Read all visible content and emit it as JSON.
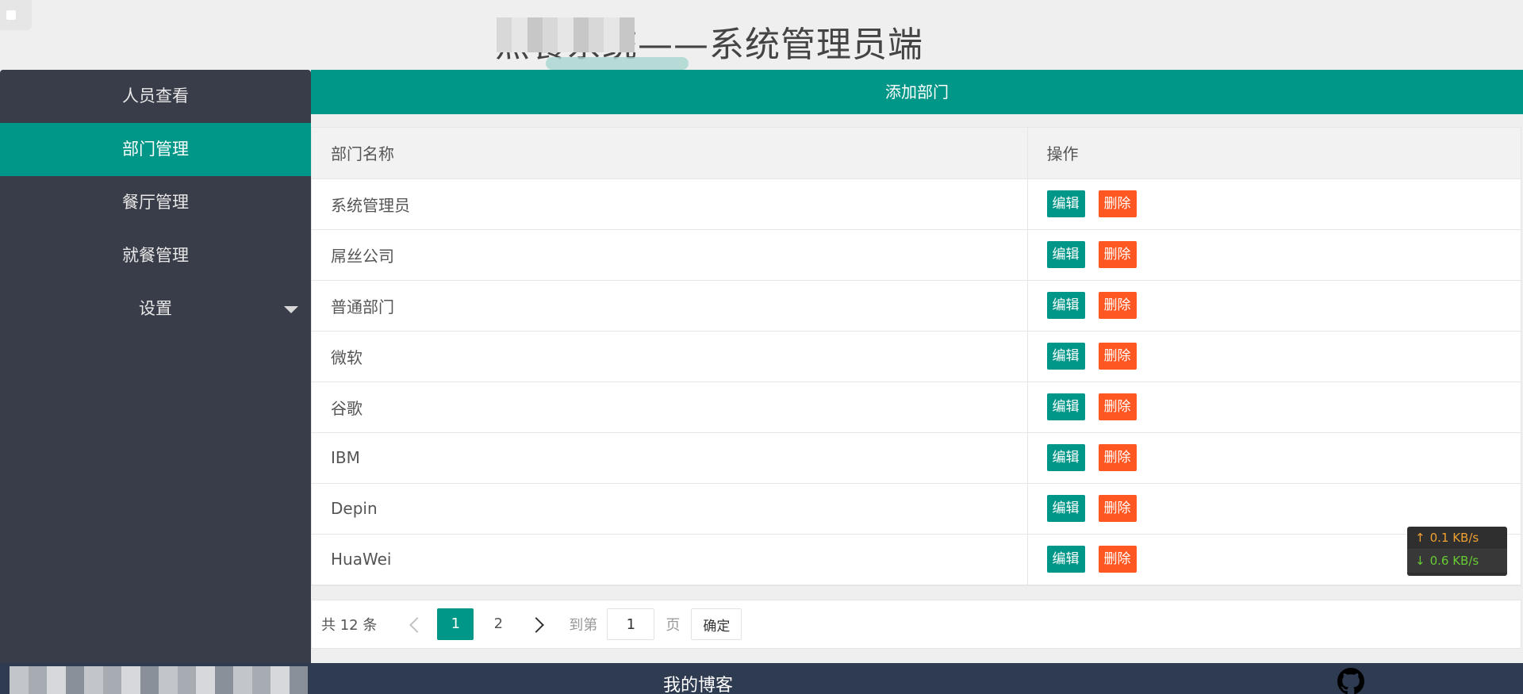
{
  "header": {
    "title": "点餐系统——系统管理员端"
  },
  "sidebar": {
    "items": [
      {
        "label": "人员查看"
      },
      {
        "label": "部门管理",
        "active": true
      },
      {
        "label": "餐厅管理"
      },
      {
        "label": "就餐管理"
      },
      {
        "label": "设置",
        "has_dropdown": true
      }
    ]
  },
  "main": {
    "add_button_label": "添加部门",
    "table": {
      "columns": [
        "部门名称",
        "操作"
      ],
      "rows": [
        {
          "name": "系统管理员"
        },
        {
          "name": "屌丝公司"
        },
        {
          "name": "普通部门"
        },
        {
          "name": "微软"
        },
        {
          "name": "谷歌"
        },
        {
          "name": "IBM"
        },
        {
          "name": "Depin"
        },
        {
          "name": "HuaWei"
        }
      ],
      "edit_label": "编辑",
      "delete_label": "删除"
    },
    "pagination": {
      "total_text": "共 12 条",
      "pages": [
        "1",
        "2"
      ],
      "current_page": "1",
      "goto_label": "到第",
      "goto_value": "1",
      "unit_label": "页",
      "confirm_label": "确定"
    }
  },
  "net_widget": {
    "upload": "0.1 KB/s",
    "download": "0.6 KB/s"
  },
  "footer": {
    "blog_label": "我的博客"
  },
  "colors": {
    "accent": "#009688",
    "danger": "#ff5722",
    "sidebar_bg": "#393d49",
    "footer_bg": "#2e3b50"
  }
}
